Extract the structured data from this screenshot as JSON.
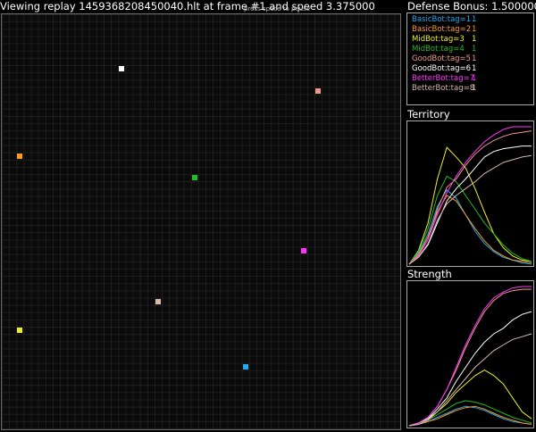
{
  "header": {
    "title": "Viewing replay 1459368208450040.hlt at frame #1 and speed 3.375000",
    "overlay_text": "press space to pause",
    "defense_bonus": "Defense Bonus: 1.500000"
  },
  "players": [
    {
      "name": "BasicBot:tag=1",
      "value": "1",
      "color": "#22aaee"
    },
    {
      "name": "BasicBot:tag=2",
      "value": "1",
      "color": "#ff9922"
    },
    {
      "name": "MidBot:tag=3",
      "value": "1",
      "color": "#eeee22"
    },
    {
      "name": "MidBot:tag=4",
      "value": "1",
      "color": "#22bb22"
    },
    {
      "name": "GoodBot:tag=5",
      "value": "1",
      "color": "#ee9988"
    },
    {
      "name": "GoodBot:tag=6",
      "value": "1",
      "color": "#ffffff"
    },
    {
      "name": "BetterBot:tag=7",
      "value": "1",
      "color": "#ff33ff"
    },
    {
      "name": "BetterBot:tag=8",
      "value": "1",
      "color": "#d8b8a8"
    }
  ],
  "board_cells": [
    {
      "player": 6,
      "col": 16,
      "row": 7
    },
    {
      "player": 5,
      "col": 43,
      "row": 10
    },
    {
      "player": 2,
      "col": 2,
      "row": 19
    },
    {
      "player": 4,
      "col": 26,
      "row": 22
    },
    {
      "player": 7,
      "col": 41,
      "row": 32
    },
    {
      "player": 8,
      "col": 21,
      "row": 39
    },
    {
      "player": 3,
      "col": 2,
      "row": 43
    },
    {
      "player": 1,
      "col": 33,
      "row": 48
    }
  ],
  "territory": {
    "title": "Territory",
    "series": [
      {
        "player": 1,
        "values": [
          0.0,
          0.08,
          0.22,
          0.42,
          0.54,
          0.48,
          0.36,
          0.24,
          0.15,
          0.09,
          0.05,
          0.03,
          0.01,
          0.0
        ]
      },
      {
        "player": 2,
        "values": [
          0.0,
          0.07,
          0.2,
          0.38,
          0.5,
          0.46,
          0.36,
          0.26,
          0.17,
          0.1,
          0.06,
          0.03,
          0.02,
          0.01
        ]
      },
      {
        "player": 3,
        "values": [
          0.0,
          0.1,
          0.3,
          0.62,
          0.85,
          0.78,
          0.7,
          0.55,
          0.38,
          0.22,
          0.12,
          0.06,
          0.03,
          0.02
        ]
      },
      {
        "player": 4,
        "values": [
          0.0,
          0.09,
          0.26,
          0.5,
          0.64,
          0.6,
          0.5,
          0.4,
          0.3,
          0.22,
          0.14,
          0.08,
          0.04,
          0.02
        ]
      },
      {
        "player": 5,
        "values": [
          0.0,
          0.06,
          0.18,
          0.4,
          0.56,
          0.62,
          0.72,
          0.8,
          0.86,
          0.9,
          0.93,
          0.95,
          0.96,
          0.97
        ]
      },
      {
        "player": 6,
        "values": [
          0.0,
          0.05,
          0.14,
          0.3,
          0.46,
          0.55,
          0.62,
          0.7,
          0.78,
          0.82,
          0.84,
          0.85,
          0.86,
          0.86
        ]
      },
      {
        "player": 7,
        "values": [
          0.0,
          0.06,
          0.18,
          0.36,
          0.52,
          0.64,
          0.74,
          0.82,
          0.89,
          0.94,
          0.98,
          1.0,
          1.0,
          1.0
        ]
      },
      {
        "player": 8,
        "values": [
          0.0,
          0.05,
          0.15,
          0.32,
          0.44,
          0.5,
          0.55,
          0.6,
          0.66,
          0.7,
          0.74,
          0.76,
          0.78,
          0.79
        ]
      }
    ]
  },
  "strength": {
    "title": "Strength",
    "series": [
      {
        "player": 1,
        "values": [
          0.0,
          0.01,
          0.03,
          0.06,
          0.09,
          0.12,
          0.14,
          0.13,
          0.11,
          0.08,
          0.05,
          0.03,
          0.02,
          0.01
        ]
      },
      {
        "player": 2,
        "values": [
          0.0,
          0.01,
          0.03,
          0.05,
          0.08,
          0.11,
          0.13,
          0.14,
          0.12,
          0.09,
          0.06,
          0.04,
          0.02,
          0.01
        ]
      },
      {
        "player": 3,
        "values": [
          0.0,
          0.02,
          0.05,
          0.1,
          0.16,
          0.24,
          0.3,
          0.36,
          0.4,
          0.36,
          0.3,
          0.2,
          0.1,
          0.05
        ]
      },
      {
        "player": 4,
        "values": [
          0.0,
          0.01,
          0.04,
          0.08,
          0.12,
          0.16,
          0.18,
          0.17,
          0.15,
          0.12,
          0.09,
          0.06,
          0.04,
          0.02
        ]
      },
      {
        "player": 5,
        "values": [
          0.0,
          0.02,
          0.06,
          0.14,
          0.26,
          0.4,
          0.56,
          0.7,
          0.82,
          0.9,
          0.95,
          0.97,
          0.98,
          0.98
        ]
      },
      {
        "player": 6,
        "values": [
          0.0,
          0.02,
          0.05,
          0.12,
          0.2,
          0.32,
          0.42,
          0.52,
          0.6,
          0.66,
          0.7,
          0.76,
          0.8,
          0.82
        ]
      },
      {
        "player": 7,
        "values": [
          0.0,
          0.02,
          0.06,
          0.14,
          0.26,
          0.42,
          0.58,
          0.72,
          0.84,
          0.92,
          0.96,
          0.99,
          1.0,
          1.0
        ]
      },
      {
        "player": 8,
        "values": [
          0.0,
          0.01,
          0.04,
          0.1,
          0.18,
          0.26,
          0.34,
          0.42,
          0.48,
          0.54,
          0.58,
          0.62,
          0.64,
          0.66
        ]
      }
    ]
  }
}
